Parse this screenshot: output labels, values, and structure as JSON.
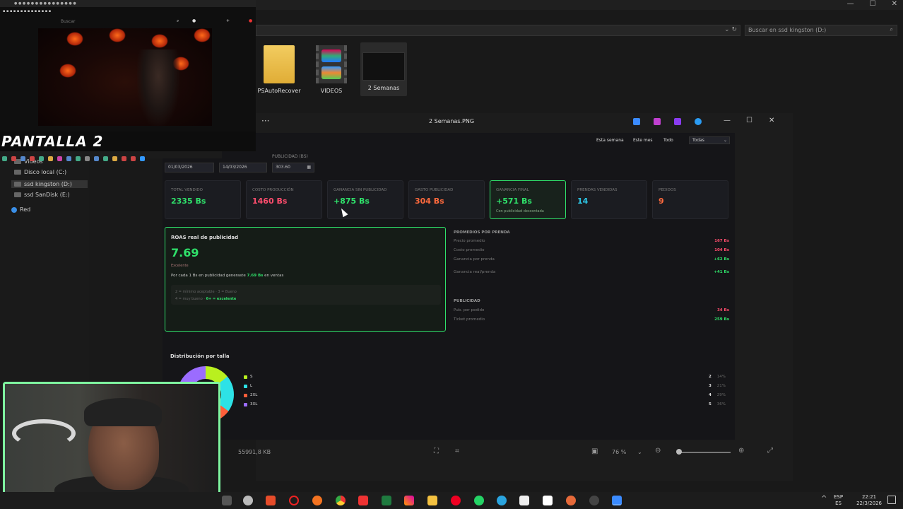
{
  "explorer": {
    "search_placeholder": "Buscar en ssd kingston (D:)",
    "files": [
      {
        "name": "PSAutoRecover"
      },
      {
        "name": "VIDEOS"
      },
      {
        "name": "2 Semanas"
      }
    ],
    "nav": {
      "videos": "Videos",
      "c": "Disco local (C:)",
      "d": "ssd kingston (D:)",
      "e": "ssd SanDisk (E:)",
      "red": "Red"
    },
    "status_size": "91,8 KB",
    "status_dims": "559"
  },
  "viewer": {
    "filename": "2 Semanas.PNG",
    "menu_dots": "···",
    "zoom": "76 %",
    "controls": {
      "minimize": "—",
      "maximize": "☐",
      "close": "✕"
    }
  },
  "dashboard": {
    "filters": [
      "Esta semana",
      "Este mes",
      "Todo"
    ],
    "select_value": "Todas",
    "pub_label": "PUBLICIDAD (BS)",
    "date_from": "01/03/2026",
    "date_to": "14/03/2026",
    "pub_value": "303.60",
    "kpis": [
      {
        "label": "TOTAL VENDIDO",
        "value": "2335 Bs",
        "color": "#2fe06a"
      },
      {
        "label": "COSTO PRODUCCIÓN",
        "value": "1460 Bs",
        "color": "#ff4d6d"
      },
      {
        "label": "GANANCIA SIN PUBLICIDAD",
        "value": "+875 Bs",
        "color": "#2fe06a"
      },
      {
        "label": "GASTO PUBLICIDAD",
        "value": "304 Bs",
        "color": "#ff6a3d"
      },
      {
        "label": "GANANCIA FINAL",
        "value": "+571 Bs",
        "color": "#2fe06a",
        "sub": "Con publicidad descontada"
      },
      {
        "label": "PRENDAS VENDIDAS",
        "value": "14",
        "color": "#2dc6e6"
      },
      {
        "label": "PEDIDOS",
        "value": "9",
        "color": "#ff6a3d"
      }
    ],
    "roas": {
      "title": "ROAS real de publicidad",
      "value": "7.69",
      "rating": "Excelente",
      "desc_pre": "Por cada 1 Bs en publicidad generaste",
      "desc_val": "7.69 Bs",
      "desc_post": "en ventas",
      "legend1": "2 = mínimo aceptable · 3 = Bueno",
      "legend2_pre": "4 = muy bueno ·",
      "legend2_hl": "6+ = excelente"
    },
    "averages": {
      "title": "PROMEDIOS POR PRENDA",
      "rows": [
        {
          "label": "Precio promedio",
          "value": "167 Bs",
          "color": "#ff4d6d"
        },
        {
          "label": "Costo promedio",
          "value": "104 Bs",
          "color": "#ff4d6d"
        },
        {
          "label": "Ganancia por prenda",
          "value": "+62 Bs",
          "color": "#2fe06a"
        },
        {
          "label": "Ganancia real/prenda",
          "value": "+41 Bs",
          "color": "#2fe06a"
        }
      ],
      "pub_title": "PUBLICIDAD",
      "pub_rows": [
        {
          "label": "Pub. por pedido",
          "value": "34 Bs",
          "color": "#ff4d6d"
        },
        {
          "label": "Ticket promedio",
          "value": "259 Bs",
          "color": "#2fe06a"
        }
      ]
    },
    "distribution": {
      "title": "Distribución por talla",
      "items": [
        {
          "size": "S",
          "count": "2",
          "pct": "14%",
          "color": "#b9f01f"
        },
        {
          "size": "L",
          "count": "3",
          "pct": "21%",
          "color": "#2de2e6"
        },
        {
          "size": "2XL",
          "count": "4",
          "pct": "29%",
          "color": "#ff5e3a"
        },
        {
          "size": "3XL",
          "count": "5",
          "pct": "36%",
          "color": "#9b6cff"
        }
      ]
    }
  },
  "overlay": {
    "pantalla": "PANTALLA 2",
    "yt_search": "Buscar"
  },
  "taskbar": {
    "lang": "ESP",
    "lang2": "ES",
    "time": "22:21",
    "date": "22/3/2026"
  }
}
